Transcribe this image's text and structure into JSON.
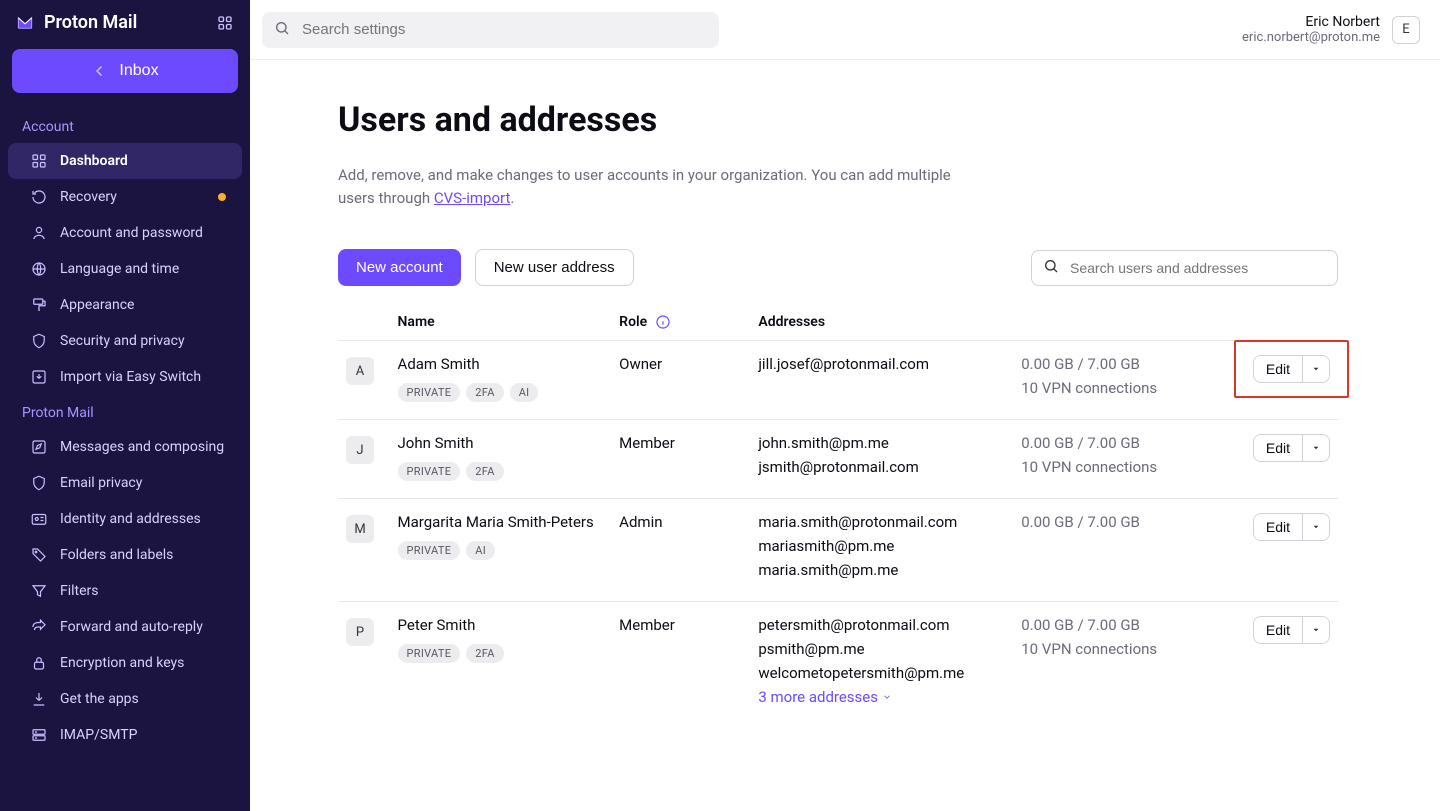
{
  "brand": "Proton Mail",
  "inboxButton": "Inbox",
  "sidebar": {
    "section1": "Account",
    "section2": "Proton Mail",
    "items1": [
      {
        "label": "Dashboard",
        "icon": "grid"
      },
      {
        "label": "Recovery",
        "icon": "recovery"
      },
      {
        "label": "Account and password",
        "icon": "user"
      },
      {
        "label": "Language and time",
        "icon": "globe"
      },
      {
        "label": "Appearance",
        "icon": "paint"
      },
      {
        "label": "Security and privacy",
        "icon": "shield"
      },
      {
        "label": "Import via Easy Switch",
        "icon": "import"
      }
    ],
    "items2": [
      {
        "label": "Messages and composing",
        "icon": "compose"
      },
      {
        "label": "Email privacy",
        "icon": "shield2"
      },
      {
        "label": "Identity and addresses",
        "icon": "idcard"
      },
      {
        "label": "Folders and labels",
        "icon": "tag"
      },
      {
        "label": "Filters",
        "icon": "funnel"
      },
      {
        "label": "Forward and auto-reply",
        "icon": "forward"
      },
      {
        "label": "Encryption and keys",
        "icon": "lock"
      },
      {
        "label": "Get the apps",
        "icon": "download"
      },
      {
        "label": "IMAP/SMTP",
        "icon": "server"
      }
    ]
  },
  "searchPlaceholder": "Search settings",
  "user": {
    "name": "Eric Norbert",
    "email": "eric.norbert@proton.me",
    "initial": "E"
  },
  "page": {
    "title": "Users and addresses",
    "desc1": "Add, remove, and make changes to user accounts in your organization. You can add multiple users through ",
    "descLink": "CVS-import",
    "desc2": ".",
    "newAccount": "New account",
    "newAddress": "New user address",
    "tableSearchPlaceholder": "Search users and addresses",
    "headers": {
      "name": "Name",
      "role": "Role",
      "addresses": "Addresses"
    },
    "editLabel": "Edit",
    "moreLink": "3 more addresses"
  },
  "rows": [
    {
      "initial": "A",
      "name": "Adam Smith",
      "badges": [
        "PRIVATE",
        "2FA",
        "AI"
      ],
      "role": "Owner",
      "addresses": [
        "jill.josef@protonmail.com"
      ],
      "storage": "0.00 GB / 7.00 GB",
      "vpn": "10 VPN connections"
    },
    {
      "initial": "J",
      "name": "John Smith",
      "badges": [
        "PRIVATE",
        "2FA"
      ],
      "role": "Member",
      "addresses": [
        "john.smith@pm.me",
        "jsmith@protonmail.com"
      ],
      "storage": "0.00 GB / 7.00 GB",
      "vpn": "10 VPN connections"
    },
    {
      "initial": "M",
      "name": "Margarita Maria Smith-Peters",
      "badges": [
        "PRIVATE",
        "AI"
      ],
      "role": "Admin",
      "addresses": [
        "maria.smith@protonmail.com",
        "mariasmith@pm.me",
        "maria.smith@pm.me"
      ],
      "storage": "0.00 GB / 7.00 GB",
      "vpn": ""
    },
    {
      "initial": "P",
      "name": "Peter Smith",
      "badges": [
        "PRIVATE",
        "2FA"
      ],
      "role": "Member",
      "addresses": [
        "petersmith@protonmail.com",
        "psmith@pm.me",
        "welcometopetersmith@pm.me"
      ],
      "storage": "0.00 GB / 7.00 GB",
      "vpn": "10 VPN connections",
      "more": true
    }
  ]
}
